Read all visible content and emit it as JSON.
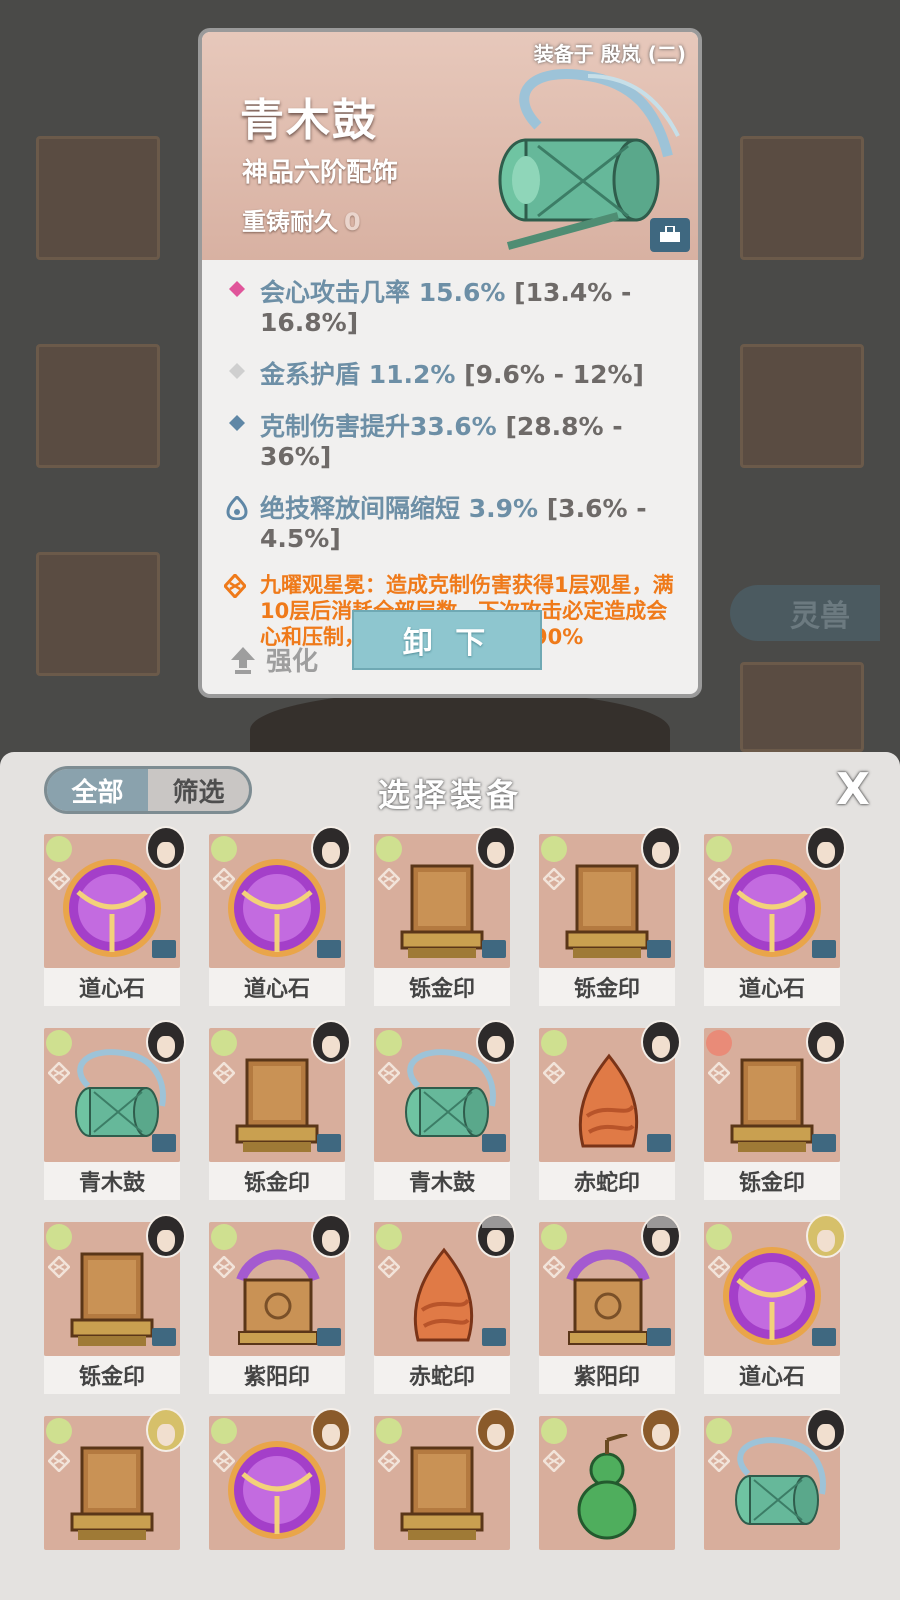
{
  "card": {
    "equipped_on": "装备于 殷岚 (二)",
    "name": "青木鼓",
    "grade": "神品六阶配饰",
    "durability_label": "重铸耐久",
    "durability_value": "0",
    "stats": [
      {
        "icon": "pink-diamond-icon",
        "color": "#e0559a",
        "text": "会心攻击几率 15.6%",
        "range": " [13.4% - 16.8%]"
      },
      {
        "icon": "gray-diamond-icon",
        "color": "#c9c9c9",
        "text": "金系护盾 11.2%",
        "range": " [9.6% - 12%]"
      },
      {
        "icon": "blue-diamond-icon",
        "color": "#5f87a6",
        "text": "克制伤害提升33.6%",
        "range": " [28.8% - 36%]"
      },
      {
        "icon": "flame-icon",
        "color": "#5f87a6",
        "text": "绝技释放间隔缩短 3.9%",
        "range": " [3.6% - 4.5%]"
      }
    ],
    "skill_text": "九曜观星冕：造成克制伤害获得1层观星，满10层后消耗全部层数，下次攻击必定造成会心和压制，且造成的伤害提高90%",
    "upgrade_label": "强化",
    "unequip_label": "卸 下"
  },
  "background": {
    "spirit_tab": "灵兽"
  },
  "panel": {
    "filter_all": "全部",
    "filter_select": "筛选",
    "title": "选择装备",
    "close": "X"
  },
  "items": [
    {
      "name": "道心石",
      "art": "orb",
      "avatar": "dark"
    },
    {
      "name": "道心石",
      "art": "orb",
      "avatar": "dark"
    },
    {
      "name": "铄金印",
      "art": "seal",
      "avatar": "dark"
    },
    {
      "name": "铄金印",
      "art": "seal",
      "avatar": "dark"
    },
    {
      "name": "道心石",
      "art": "orb",
      "avatar": "dark"
    },
    {
      "name": "青木鼓",
      "art": "drum",
      "avatar": "dark"
    },
    {
      "name": "铄金印",
      "art": "seal",
      "avatar": "dark"
    },
    {
      "name": "青木鼓",
      "art": "drum",
      "avatar": "dark"
    },
    {
      "name": "赤蛇印",
      "art": "snake",
      "avatar": "dark"
    },
    {
      "name": "铄金印",
      "art": "seal",
      "avatar": "dark",
      "elem": "red"
    },
    {
      "name": "铄金印",
      "art": "seal",
      "avatar": "dark"
    },
    {
      "name": "紫阳印",
      "art": "purple-seal",
      "avatar": "dark"
    },
    {
      "name": "赤蛇印",
      "art": "snake",
      "avatar": "fox"
    },
    {
      "name": "紫阳印",
      "art": "purple-seal",
      "avatar": "fox"
    },
    {
      "name": "道心石",
      "art": "orb",
      "avatar": "yellow"
    },
    {
      "name": "",
      "art": "seal",
      "avatar": "yellow"
    },
    {
      "name": "",
      "art": "orb",
      "avatar": "gold"
    },
    {
      "name": "",
      "art": "seal",
      "avatar": "gold"
    },
    {
      "name": "",
      "art": "gourd",
      "avatar": "gold"
    },
    {
      "name": "",
      "art": "drum",
      "avatar": "dark"
    }
  ],
  "colors": {
    "stat_blue": "#6d8fa6",
    "range_gray": "#6e6a68",
    "skill_orange": "#ef7a1a",
    "tile_bg": "#d8ae9c",
    "button_teal": "#8ec6cf"
  }
}
